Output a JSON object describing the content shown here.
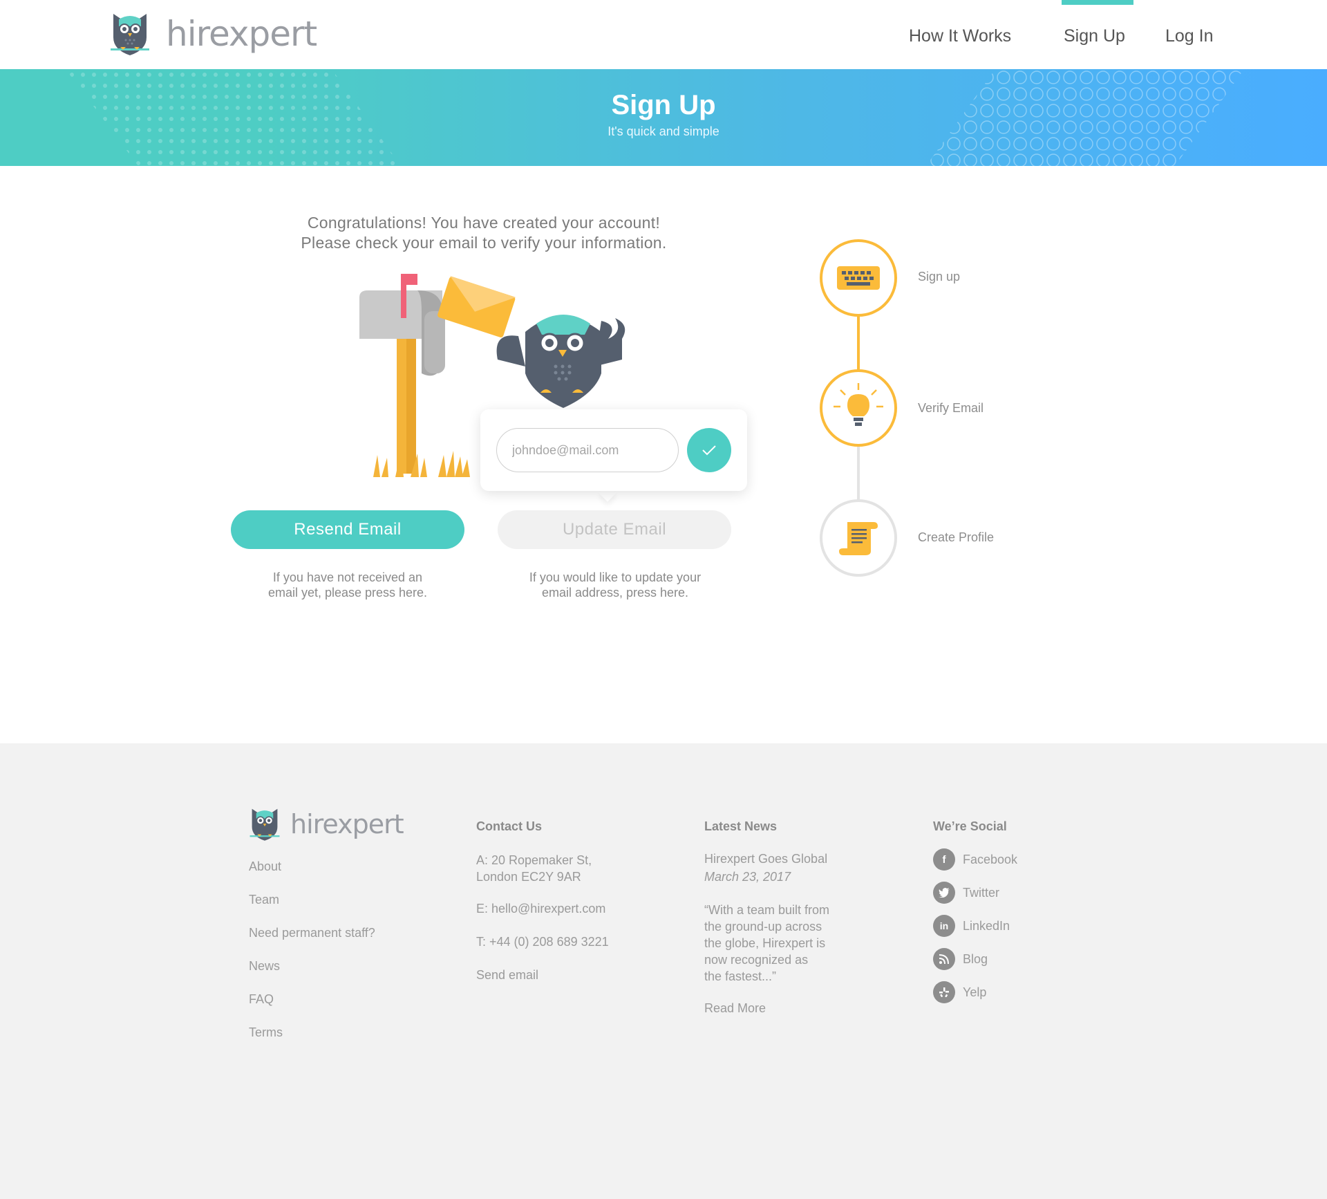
{
  "header": {
    "brand": "hirexpert",
    "nav": [
      {
        "label": "How It Works"
      },
      {
        "label": "Sign Up"
      },
      {
        "label": "Log In"
      }
    ],
    "active_nav": "Sign Up",
    "accent_color": "#4ecdc4"
  },
  "banner": {
    "title": "Sign Up",
    "subtitle": "It's quick and simple",
    "gradient_start": "#4ecdc4",
    "gradient_end": "#4aadff"
  },
  "main": {
    "message_line1": "Congratulations! You have created your account!",
    "message_line2": "Please check your email to verify your information.",
    "email_placeholder": "johndoe@mail.com",
    "confirm_icon": "checkmark-icon",
    "resend_button": "Resend Email",
    "update_button": "Update Email",
    "resend_help_line1": "If you have not received an",
    "resend_help_line2": "email yet, please press here.",
    "update_help_line1": "If you would like to update your",
    "update_help_line2": "email address, press here."
  },
  "steps": [
    {
      "label": "Sign up",
      "icon": "keyboard-icon",
      "state": "done"
    },
    {
      "label": "Verify Email",
      "icon": "lightbulb-icon",
      "state": "current"
    },
    {
      "label": "Create Profile",
      "icon": "scroll-icon",
      "state": "pending"
    }
  ],
  "step_color": "#fbbb3a",
  "footer": {
    "brand": "hirexpert",
    "links": [
      "About",
      "Team",
      "Need permanent staff?",
      "News",
      "FAQ",
      "Terms"
    ],
    "contact": {
      "heading": "Contact Us",
      "address_line1": "A: 20 Ropemaker St,",
      "address_line2": "London EC2Y 9AR",
      "email": "E: hello@hirexpert.com",
      "phone": "T: +44 (0) 208 689 3221",
      "send": "Send email"
    },
    "news": {
      "heading": "Latest News",
      "title": "Hirexpert Goes Global",
      "date": "March 23, 2017",
      "excerpt": [
        "“With a team built from",
        "the ground-up across",
        "the globe, Hirexpert is",
        "now recognized as",
        "the fastest...”"
      ],
      "read_more": "Read More"
    },
    "social": {
      "heading": "We’re Social",
      "items": [
        {
          "label": "Facebook",
          "icon": "facebook-icon"
        },
        {
          "label": "Twitter",
          "icon": "twitter-icon"
        },
        {
          "label": "LinkedIn",
          "icon": "linkedin-icon"
        },
        {
          "label": "Blog",
          "icon": "rss-icon"
        },
        {
          "label": "Yelp",
          "icon": "yelp-icon"
        }
      ]
    }
  }
}
